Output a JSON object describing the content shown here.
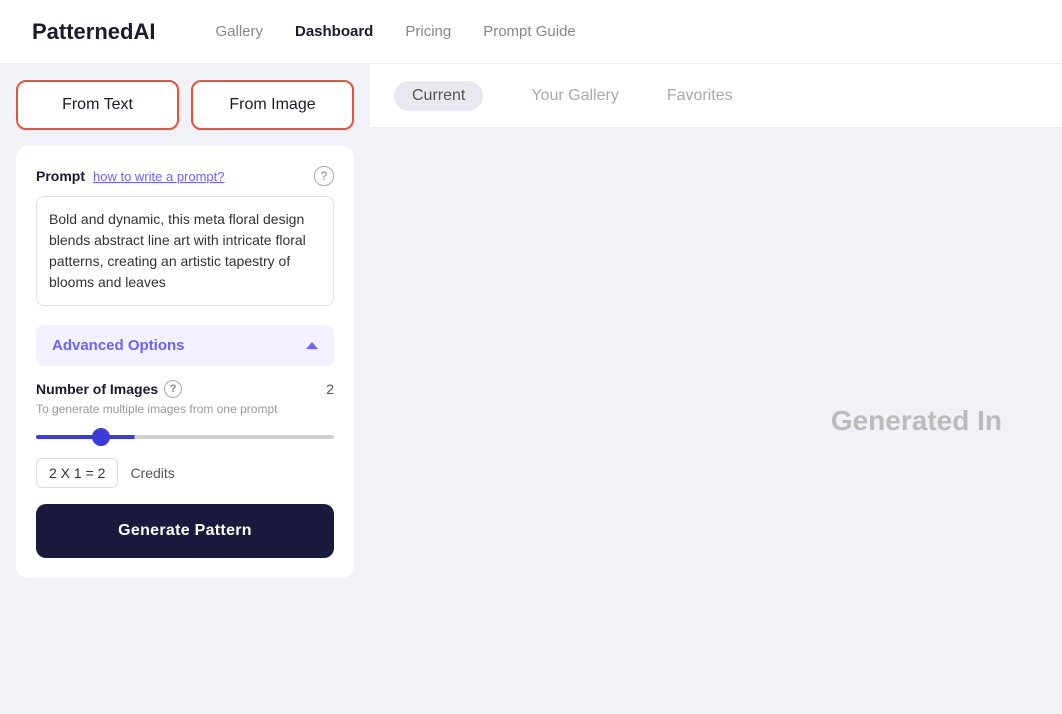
{
  "header": {
    "logo": "PatternedAI",
    "nav": [
      {
        "label": "Gallery",
        "active": false
      },
      {
        "label": "Dashboard",
        "active": true
      },
      {
        "label": "Pricing",
        "active": false
      },
      {
        "label": "Prompt Guide",
        "active": false
      }
    ]
  },
  "left": {
    "tab_from_text": "From Text",
    "tab_from_image": "From Image",
    "prompt_label": "Prompt",
    "prompt_link": "how to write a prompt?",
    "prompt_value": "Bold and dynamic, this meta floral design blends abstract line art with intricate floral patterns, creating an artistic tapestry of blooms and leaves",
    "advanced_options_label": "Advanced Options",
    "num_images_label": "Number of Images",
    "num_images_subtext": "To generate multiple images from one prompt",
    "num_images_value": "2",
    "slider_value": "2",
    "credits_formula": "2 X 1 = 2",
    "credits_label": "Credits",
    "generate_btn": "Generate Pattern"
  },
  "right": {
    "tabs": [
      {
        "label": "Current",
        "active": true
      },
      {
        "label": "Your Gallery",
        "active": false
      },
      {
        "label": "Favorites",
        "active": false
      }
    ],
    "generated_text": "Generated In"
  }
}
